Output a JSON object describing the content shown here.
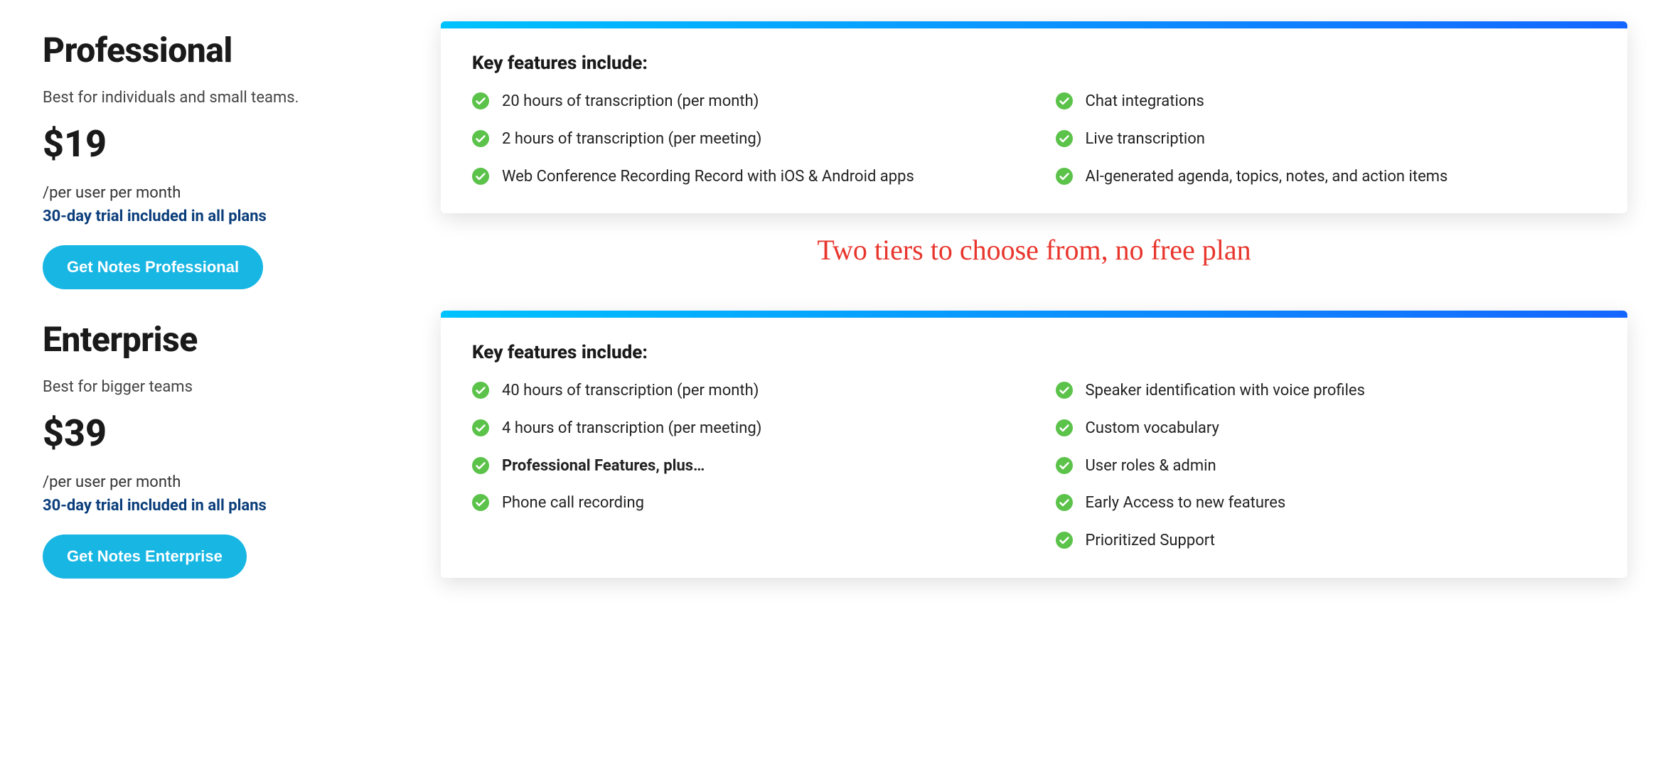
{
  "annotation": "Two tiers to choose from, no free plan",
  "features_heading": "Key features include:",
  "plans": [
    {
      "id": "professional",
      "title": "Professional",
      "subtitle": "Best for individuals and small teams.",
      "price": "$19",
      "per": "/per user per month",
      "trial": "30-day trial included in all plans",
      "cta": "Get Notes Professional",
      "features_left": [
        {
          "text": "20 hours of transcription (per month)",
          "bold": false
        },
        {
          "text": "2 hours of transcription (per meeting)",
          "bold": false
        },
        {
          "text": "Web Conference Recording Record with iOS & Android apps",
          "bold": false
        }
      ],
      "features_right": [
        {
          "text": "Chat integrations",
          "bold": false
        },
        {
          "text": "Live transcription",
          "bold": false
        },
        {
          "text": "AI-generated agenda, topics, notes, and action items",
          "bold": false
        }
      ]
    },
    {
      "id": "enterprise",
      "title": "Enterprise",
      "subtitle": "Best for bigger teams",
      "price": "$39",
      "per": "/per user per month",
      "trial": "30-day trial included in all plans",
      "cta": "Get Notes Enterprise",
      "features_left": [
        {
          "text": "40 hours of transcription (per month)",
          "bold": false
        },
        {
          "text": "4 hours of transcription (per meeting)",
          "bold": false
        },
        {
          "text": "Professional Features, plus…",
          "bold": true
        },
        {
          "text": "Phone call recording",
          "bold": false
        }
      ],
      "features_right": [
        {
          "text": "Speaker identification with voice profiles",
          "bold": false
        },
        {
          "text": "Custom vocabulary",
          "bold": false
        },
        {
          "text": "User roles & admin",
          "bold": false
        },
        {
          "text": "Early Access to new features",
          "bold": false
        },
        {
          "text": "Prioritized Support",
          "bold": false
        }
      ]
    }
  ]
}
